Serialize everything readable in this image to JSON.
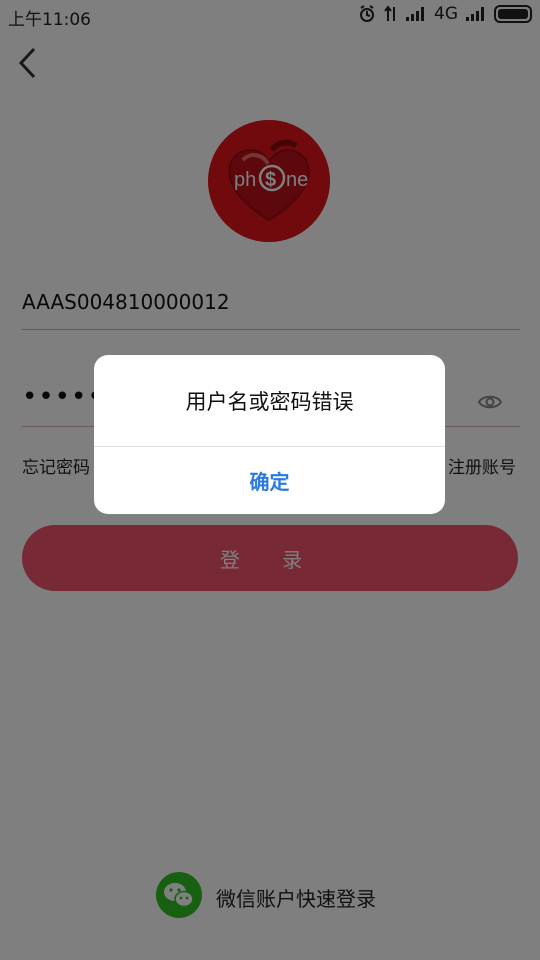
{
  "statusbar": {
    "time": "上午11:06",
    "network": "4G"
  },
  "login": {
    "username_value": "AAAS004810000012",
    "password_mask": "••••••",
    "forgot_label": "忘记密码",
    "register_label": "注册账号",
    "login_button_label": "登 录",
    "wechat_label": "微信账户快速登录",
    "logo_text_left": "ph",
    "logo_text_symbol": "$",
    "logo_text_right": "ne"
  },
  "dialog": {
    "message": "用户名或密码错误",
    "confirm_label": "确定"
  },
  "colors": {
    "accent": "#f0536c",
    "dialog_button": "#2a7ae2",
    "logo_red": "#e3151b",
    "wechat_green": "#2fbf22"
  }
}
